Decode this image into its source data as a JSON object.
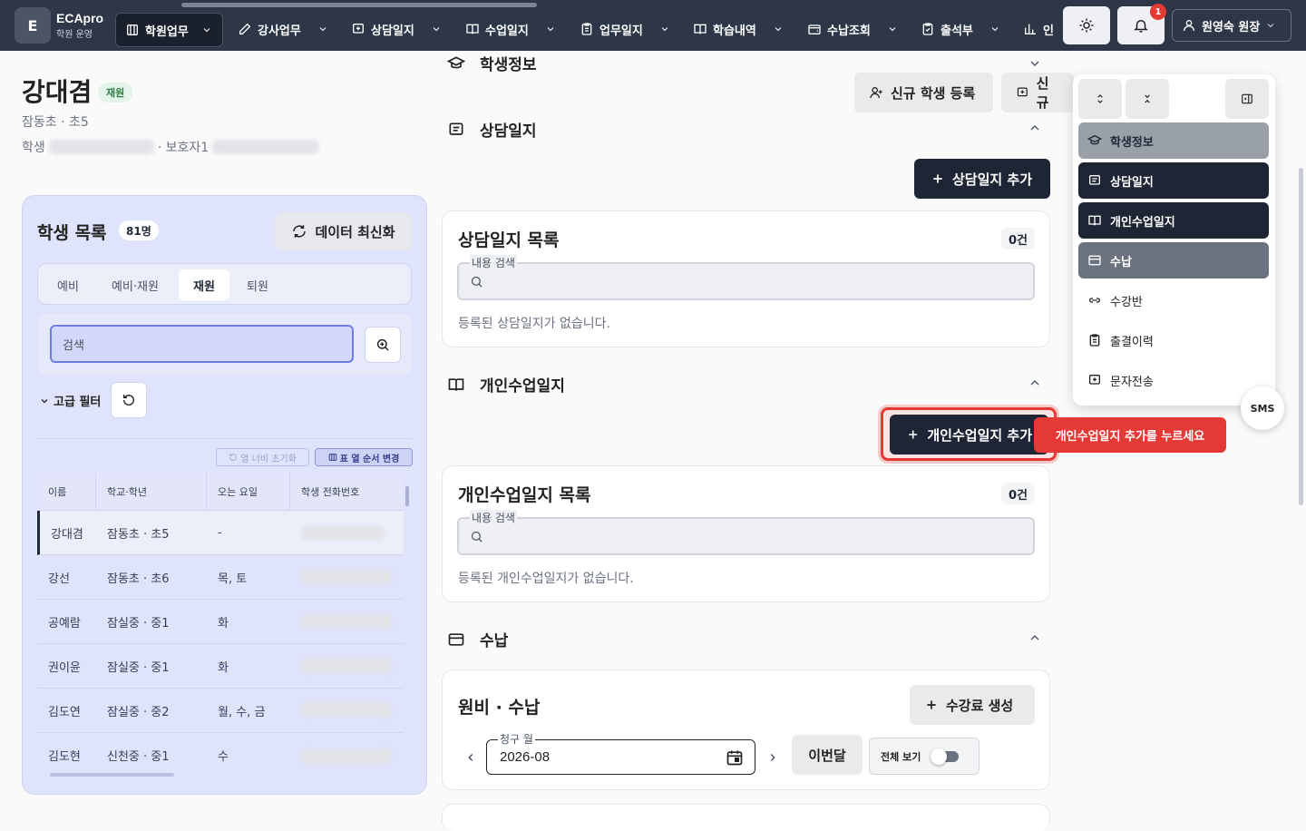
{
  "app": {
    "logo_letter": "E",
    "name": "ECApro",
    "subtitle": "학원 운영"
  },
  "nav": [
    {
      "label": "학원업무",
      "icon": "building-icon",
      "active": true
    },
    {
      "label": "강사업무",
      "icon": "edit-icon"
    },
    {
      "label": "상담일지",
      "icon": "message-plus-icon"
    },
    {
      "label": "수업일지",
      "icon": "book-icon"
    },
    {
      "label": "업무일지",
      "icon": "clipboard-icon"
    },
    {
      "label": "학습내역",
      "icon": "book-open-icon"
    },
    {
      "label": "수납조회",
      "icon": "wallet-icon"
    },
    {
      "label": "출석부",
      "icon": "clipboard-check-icon"
    },
    {
      "label": "인",
      "icon": "chart-icon"
    }
  ],
  "topbar": {
    "notification_count": "1",
    "user_label": "원영숙 원장"
  },
  "student": {
    "name": "강대겸",
    "status_badge": "재원",
    "school": "잠동초 · 초5",
    "phone_label": "학생",
    "guardian_label": "· 보호자1"
  },
  "list": {
    "title": "학생 목록",
    "count": "81명",
    "refresh_label": "데이터 최신화",
    "tabs": [
      "예비",
      "예비·재원",
      "재원",
      "퇴원"
    ],
    "active_tab": "재원",
    "search_placeholder": "검색",
    "advanced_filter": "고급 필터",
    "reset_width_label": "열 너비 초기화",
    "reorder_label": "표 열 순서 변경",
    "columns": [
      "이름",
      "학교·학년",
      "오는 요일",
      "학생 전화번호"
    ],
    "rows": [
      {
        "name": "강대겸",
        "school": "잠동초 · 초5",
        "days": "-"
      },
      {
        "name": "강선",
        "school": "잠동초 · 초6",
        "days": "목, 토"
      },
      {
        "name": "공예람",
        "school": "잠실중 · 중1",
        "days": "화"
      },
      {
        "name": "권이윤",
        "school": "잠실중 · 중1",
        "days": "화"
      },
      {
        "name": "김도연",
        "school": "잠실중 · 중2",
        "days": "월, 수, 금"
      },
      {
        "name": "김도현",
        "school": "신천중 · 중1",
        "days": "수"
      }
    ]
  },
  "sections": {
    "student_info": "학생정보",
    "counsel": "상담일지",
    "private_class": "개인수업일지",
    "payment": "수납"
  },
  "buttons": {
    "new_student": "신규 학생 등록",
    "new_other": "신규",
    "add_counsel": "상담일지 추가",
    "add_private": "개인수업일지 추가",
    "create_fee": "수강료 생성",
    "this_month": "이번달"
  },
  "counsel_card": {
    "title": "상담일지 목록",
    "count": "0건",
    "search_label": "내용 검색",
    "empty": "등록된 상담일지가 없습니다."
  },
  "private_card": {
    "title": "개인수업일지 목록",
    "count": "0건",
    "search_label": "내용 검색",
    "empty": "등록된 개인수업일지가 없습니다."
  },
  "payment_card": {
    "title": "원비 · 수납",
    "month_label": "청구 월",
    "month_value": "2026-08",
    "show_all": "전체 보기"
  },
  "tooltip": "개인수업일지 추가를 누르세요",
  "float_nav": [
    {
      "label": "학생정보",
      "style": "lgray",
      "icon": "graduation-cap-icon"
    },
    {
      "label": "상담일지",
      "style": "dark",
      "icon": "message-icon"
    },
    {
      "label": "개인수업일지",
      "style": "dark",
      "icon": "book-icon"
    },
    {
      "label": "수납",
      "style": "gray",
      "icon": "card-icon"
    },
    {
      "label": "수강반",
      "style": "plain",
      "icon": "link-icon"
    },
    {
      "label": "출결이력",
      "style": "plain",
      "icon": "clipboard-icon"
    },
    {
      "label": "문자전송",
      "style": "plain",
      "icon": "message-plus-icon"
    }
  ],
  "sms_label": "SMS",
  "colors": {
    "topbar": "#2d3748",
    "panel": "#dfe3fb",
    "accent_dark": "#1e2535",
    "highlight": "#e53935"
  }
}
